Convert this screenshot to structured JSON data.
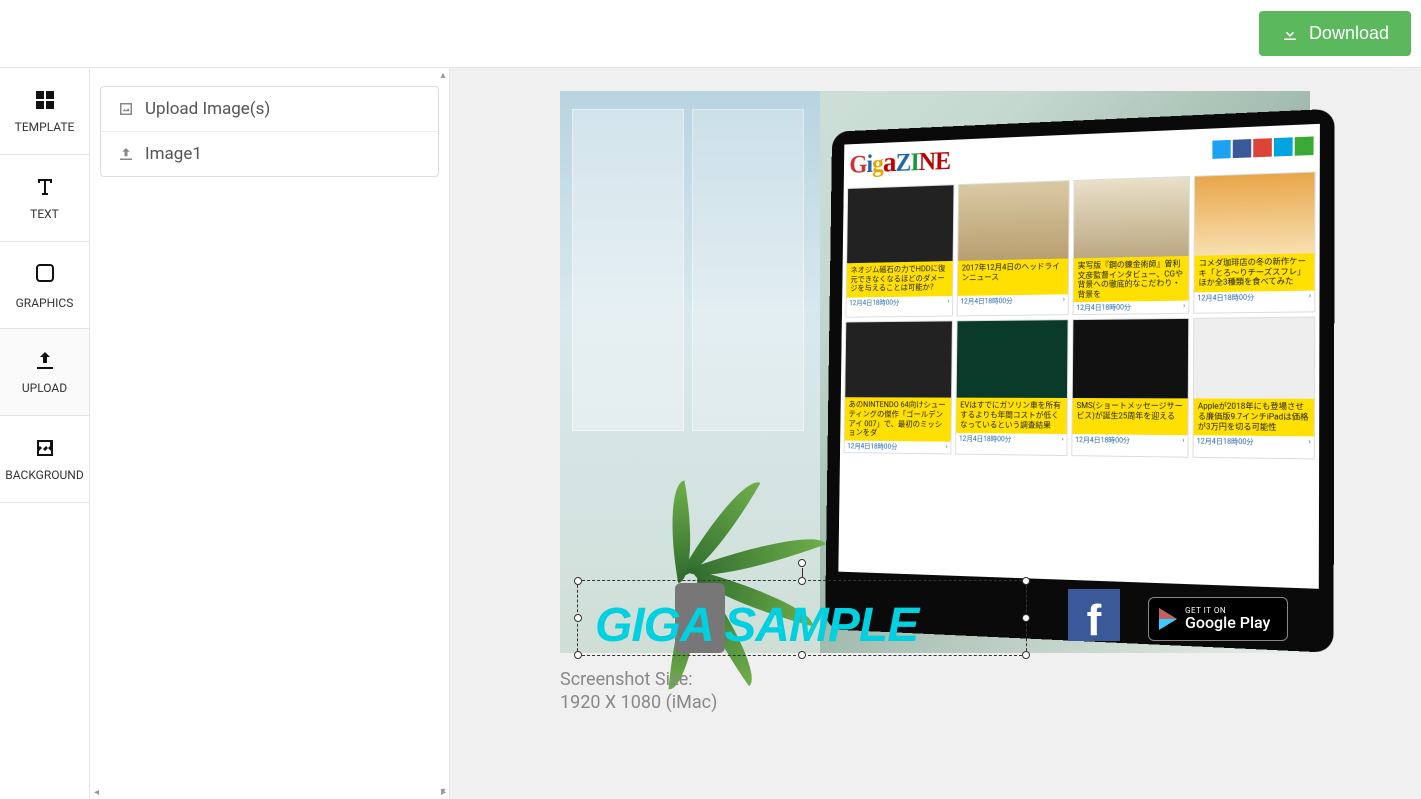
{
  "topbar": {
    "download_label": "Download"
  },
  "sidebar": {
    "items": [
      {
        "label": "TEMPLATE"
      },
      {
        "label": "TEXT"
      },
      {
        "label": "GRAPHICS"
      },
      {
        "label": "UPLOAD"
      },
      {
        "label": "BACKGROUND"
      }
    ]
  },
  "panel": {
    "upload_label": "Upload Image(s)",
    "image1_label": "Image1"
  },
  "canvas": {
    "sample_text": "GIGA SAMPLE",
    "facebook": "f",
    "google_play_small": "GET IT ON",
    "google_play_big": "Google Play",
    "caption_line1": "Screenshot Size:",
    "caption_line2": "1920 X 1080 (iMac)",
    "mock_logo_letters": [
      "G",
      "i",
      "g",
      "a",
      "Z",
      "I",
      "N",
      "E"
    ],
    "cards": [
      "ネオジム磁石の力でHDDに復元できなくなるほどのダメージを与えることは可能か？",
      "2017年12月4日のヘッドラインニュース",
      "実写版『鋼の錬金術師』曽利文彦監督インタビュー、CGや背景への徹底的なこだわり・背景を",
      "コメダ珈琲店の冬の新作ケーキ「とろ～りチーズスフレ」ほか全3種類を食べてみた",
      "あのNINTENDO 64向けシューティングの傑作「ゴールデンアイ 007」で、最初のミッションをダ",
      "EVはすでにガソリン車を所有するよりも年間コストが低くなっているという調査結果",
      "SMS(ショートメッセージサービス)が誕生25周年を迎える",
      "Appleが2018年にも登場させる廉価版9.7インチiPadは価格が3万円を切る可能性"
    ],
    "card_meta": "12月4日18時00分"
  }
}
